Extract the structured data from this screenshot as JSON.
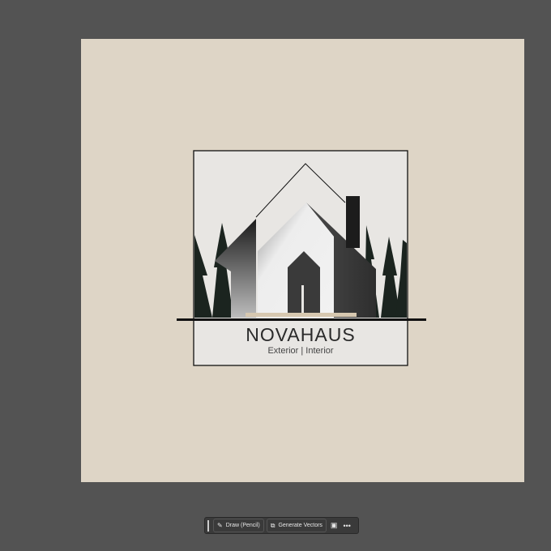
{
  "logo": {
    "name": "NOVAHAUS",
    "tagline": "Exterior | Interior"
  },
  "toolbar": {
    "draw_label": "Draw (Pencil)",
    "generate_label": "Generate Vectors",
    "more_label": "•••"
  },
  "colors": {
    "canvas": "#535353",
    "artboard": "#ded5c6",
    "logo_bg": "#e8e6e3",
    "ink": "#111111"
  }
}
